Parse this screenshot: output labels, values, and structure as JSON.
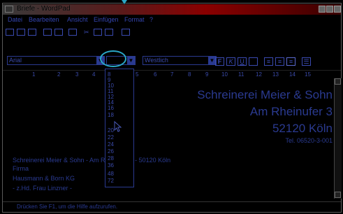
{
  "window": {
    "title": "Briefe - WordPad"
  },
  "menu": [
    "Datei",
    "Bearbeiten",
    "Ansicht",
    "Einfügen",
    "Format",
    "?"
  ],
  "format_bar": {
    "font": "Arial",
    "size": "",
    "script": "Westlich",
    "bold_label": "F",
    "italic_label": "K",
    "underline_label": "U"
  },
  "ruler": {
    "ticks": [
      "1",
      "2",
      "3",
      "4",
      "5",
      "6",
      "7",
      "8",
      "9",
      "10",
      "11",
      "12",
      "13",
      "14",
      "15"
    ]
  },
  "font_size_list": [
    "8",
    "9",
    "10",
    "11",
    "12",
    "14",
    "16",
    "18",
    "20",
    "22",
    "24",
    "26",
    "28",
    "36",
    "48",
    "72"
  ],
  "document": {
    "sender_lines": [
      "Schreinerei Meier & Sohn",
      "Am Rheinufer 3",
      "52120 Köln",
      "Tel. 06520-3-001"
    ],
    "return_address": "Schreinerei Meier & Sohn - Am Rheinufer 3 - 50120 Köln",
    "recipient": [
      "Firma",
      "Hausmann & Born KG",
      "- z.Hd. Frau Linzner -"
    ]
  },
  "status": {
    "text": "Drücken Sie F1, um die Hilfe aufzurufen."
  },
  "colors": {
    "accent": "#3a4aa8",
    "highlight_circle": "#2aa7c7",
    "titlebar": "#8a0000"
  }
}
